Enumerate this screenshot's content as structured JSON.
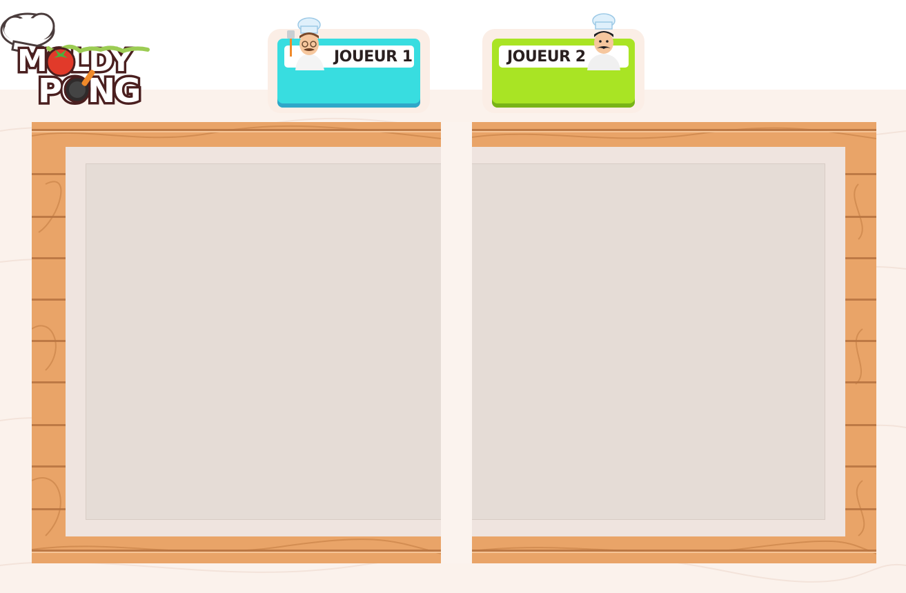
{
  "logo": {
    "line1": "MOLDY",
    "line2": "PONG",
    "icon": "chef-hat-tomato-pan-logo"
  },
  "players": [
    {
      "label": "JOUEUR 1",
      "color": "#38dde0",
      "shade": "#2fa7c8",
      "avatar": "chef-with-glasses-icon"
    },
    {
      "label": "JOUEUR 2",
      "color": "#a9e424",
      "shade": "#78b317",
      "avatar": "chef-with-mustache-icon"
    }
  ],
  "colors": {
    "background": "#fbf2ec",
    "wood": "#e9a468",
    "mat_outer": "#efe4df",
    "mat_inner": "#e5dcd6"
  }
}
